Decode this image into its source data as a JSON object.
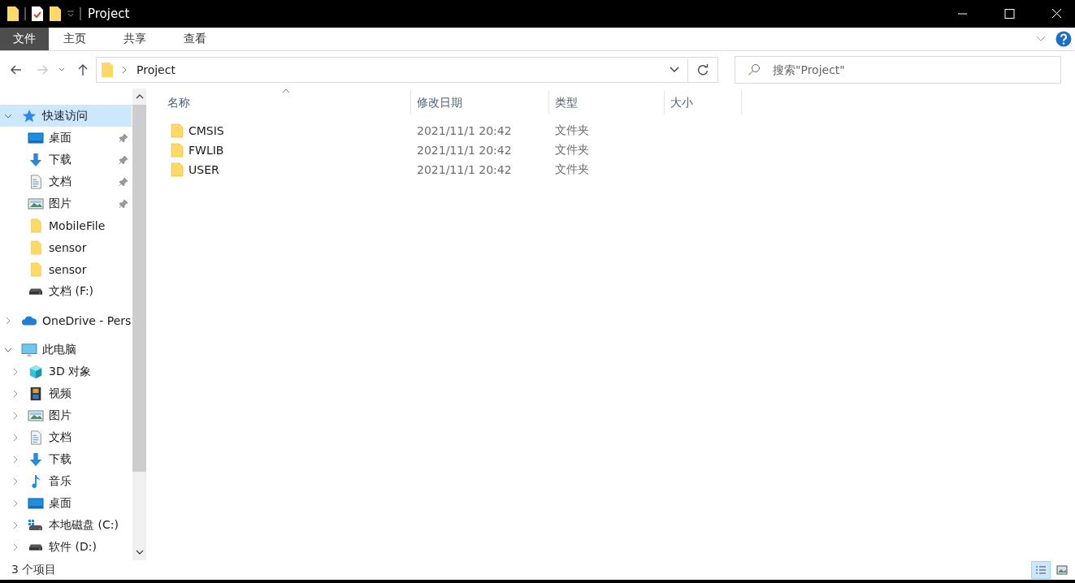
{
  "window": {
    "title": "Project"
  },
  "ribbon_tabs": [
    {
      "label": "文件",
      "selected": true
    },
    {
      "label": "主页",
      "selected": false
    },
    {
      "label": "共享",
      "selected": false
    },
    {
      "label": "查看",
      "selected": false
    }
  ],
  "address_bar": {
    "path": "Project"
  },
  "search": {
    "placeholder": "搜索\"Project\""
  },
  "sidebar": {
    "items": [
      {
        "label": "快速访问",
        "kind": "star",
        "expanded": true,
        "selected": true,
        "children": [
          {
            "label": "桌面",
            "kind": "desktop",
            "pinned": true
          },
          {
            "label": "下载",
            "kind": "download",
            "pinned": true
          },
          {
            "label": "文档",
            "kind": "document",
            "pinned": true
          },
          {
            "label": "图片",
            "kind": "pictures",
            "pinned": true
          },
          {
            "label": "MobileFile",
            "kind": "folder",
            "pinned": false
          },
          {
            "label": "sensor",
            "kind": "folder",
            "pinned": false
          },
          {
            "label": "sensor",
            "kind": "folder",
            "pinned": false
          },
          {
            "label": "文档 (F:)",
            "kind": "drive",
            "pinned": false
          }
        ]
      },
      {
        "label": "OneDrive - Pers",
        "kind": "cloud",
        "expanded": false,
        "selected": false
      },
      {
        "label": "此电脑",
        "kind": "pc",
        "expanded": true,
        "selected": false,
        "children": [
          {
            "label": "3D 对象",
            "kind": "cube",
            "expanded": false
          },
          {
            "label": "视频",
            "kind": "video",
            "expanded": false
          },
          {
            "label": "图片",
            "kind": "pictures",
            "expanded": false
          },
          {
            "label": "文档",
            "kind": "document",
            "expanded": false
          },
          {
            "label": "下载",
            "kind": "download",
            "expanded": false
          },
          {
            "label": "音乐",
            "kind": "music",
            "expanded": false
          },
          {
            "label": "桌面",
            "kind": "desktop",
            "expanded": false
          },
          {
            "label": "本地磁盘 (C:)",
            "kind": "system-drive",
            "expanded": false
          },
          {
            "label": "软件 (D:)",
            "kind": "drive",
            "expanded": false
          }
        ]
      }
    ]
  },
  "table": {
    "columns": [
      "名称",
      "修改日期",
      "类型",
      "大小"
    ],
    "rows": [
      {
        "name": "CMSIS",
        "modified": "2021/11/1 20:42",
        "type": "文件夹"
      },
      {
        "name": "FWLIB",
        "modified": "2021/11/1 20:42",
        "type": "文件夹"
      },
      {
        "name": "USER",
        "modified": "2021/11/1 20:42",
        "type": "文件夹"
      }
    ]
  },
  "status_bar": {
    "count": "3 个项目"
  },
  "view_buttons": [
    {
      "kind": "details",
      "selected": true
    },
    {
      "kind": "large-icons",
      "selected": false
    }
  ]
}
